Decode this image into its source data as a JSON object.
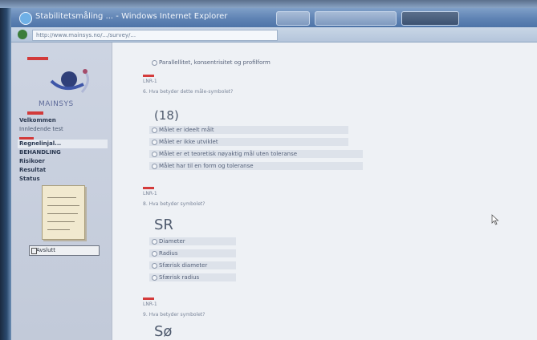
{
  "window": {
    "title": "Stabilitetsmåling ... - Windows Internet Explorer",
    "url": "http://www.mainsys.no/.../survey/..."
  },
  "sidebar": {
    "logo_text": "MAINSYS",
    "nav": [
      "Velkommen",
      "Innledende test",
      "",
      "Regnelinjal...",
      "BEHANDLING",
      "Risikoer",
      "Resultat",
      "Status"
    ],
    "exit_label": "Avslutt"
  },
  "content": {
    "top_option": "Parallellitet, konsentrisitet og profilform",
    "q1": {
      "label": "LNR-1",
      "question": "6. Hva betyder dette måle-symbolet?",
      "symbol": "(18)",
      "options": [
        "Målet er ideelt målt",
        "Målet er ikke utviklet",
        "Målet er et teoretisk nøyaktig mål uten toleranse",
        "Målet har til en form og toleranse"
      ]
    },
    "q2": {
      "label": "LNR-1",
      "question": "8. Hva betyder symbolet?",
      "symbol": "SR",
      "options": [
        "Diameter",
        "Radius",
        "Sfærisk diameter",
        "Sfærisk radius"
      ]
    },
    "q3": {
      "label": "LNR-1",
      "question": "9. Hva betyder symbolet?",
      "symbol": "Sø"
    }
  }
}
